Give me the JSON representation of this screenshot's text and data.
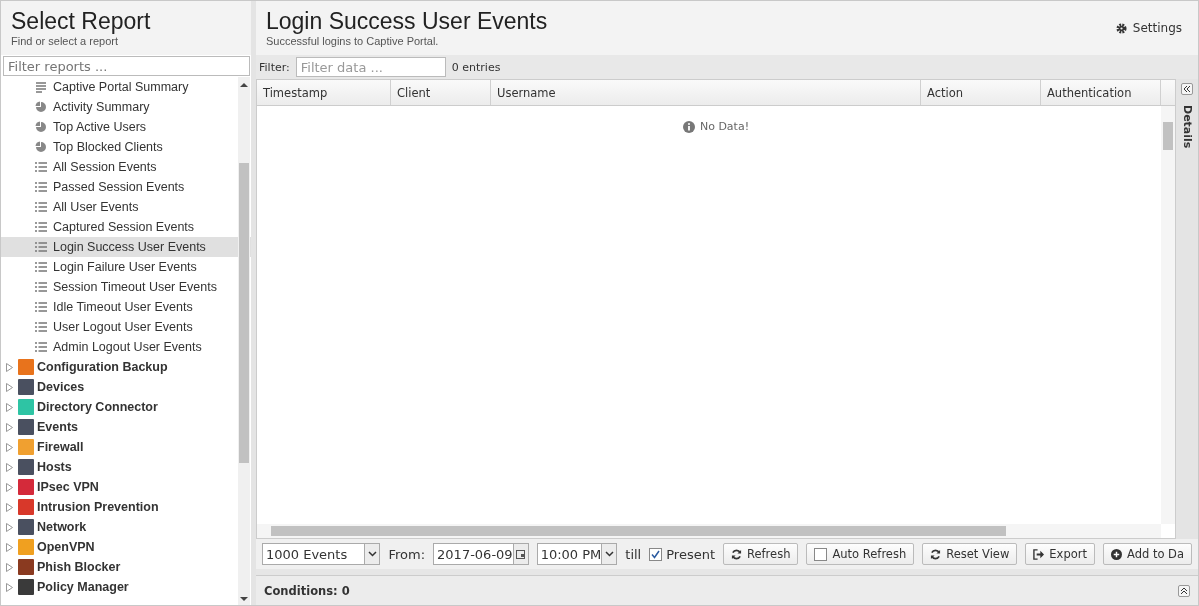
{
  "sidebar": {
    "title": "Select Report",
    "subtitle": "Find or select a report",
    "filter_placeholder": "Filter reports ...",
    "items": [
      {
        "kind": "summary",
        "label": "Captive Portal Summary",
        "selected": false
      },
      {
        "kind": "chart",
        "label": "Activity Summary",
        "selected": false
      },
      {
        "kind": "chart",
        "label": "Top Active Users",
        "selected": false
      },
      {
        "kind": "chart",
        "label": "Top Blocked Clients",
        "selected": false
      },
      {
        "kind": "events",
        "label": "All Session Events",
        "selected": false
      },
      {
        "kind": "events",
        "label": "Passed Session Events",
        "selected": false
      },
      {
        "kind": "events",
        "label": "All User Events",
        "selected": false
      },
      {
        "kind": "events",
        "label": "Captured Session Events",
        "selected": false
      },
      {
        "kind": "events",
        "label": "Login Success User Events",
        "selected": true
      },
      {
        "kind": "events",
        "label": "Login Failure User Events",
        "selected": false
      },
      {
        "kind": "events",
        "label": "Session Timeout User Events",
        "selected": false
      },
      {
        "kind": "events",
        "label": "Idle Timeout User Events",
        "selected": false
      },
      {
        "kind": "events",
        "label": "User Logout User Events",
        "selected": false
      },
      {
        "kind": "events",
        "label": "Admin Logout User Events",
        "selected": false
      },
      {
        "kind": "app",
        "label": "Configuration Backup",
        "expanded": false,
        "color": "#e8731c"
      },
      {
        "kind": "app",
        "label": "Devices",
        "expanded": false,
        "color": "#4a5060"
      },
      {
        "kind": "app",
        "label": "Directory Connector",
        "expanded": false,
        "color": "#2ec4a4"
      },
      {
        "kind": "app",
        "label": "Events",
        "expanded": false,
        "color": "#4a5060"
      },
      {
        "kind": "app",
        "label": "Firewall",
        "expanded": false,
        "color": "#f0a030"
      },
      {
        "kind": "app",
        "label": "Hosts",
        "expanded": false,
        "color": "#4a5060"
      },
      {
        "kind": "app",
        "label": "IPsec VPN",
        "expanded": false,
        "color": "#d42a3a"
      },
      {
        "kind": "app",
        "label": "Intrusion Prevention",
        "expanded": false,
        "color": "#d8382a"
      },
      {
        "kind": "app",
        "label": "Network",
        "expanded": false,
        "color": "#4a5060"
      },
      {
        "kind": "app",
        "label": "OpenVPN",
        "expanded": false,
        "color": "#f0a020"
      },
      {
        "kind": "app",
        "label": "Phish Blocker",
        "expanded": false,
        "color": "#8a3a20"
      },
      {
        "kind": "app",
        "label": "Policy Manager",
        "expanded": false,
        "color": "#3a3a3a"
      }
    ]
  },
  "report": {
    "title": "Login Success User Events",
    "subtitle": "Successful logins to Captive Portal.",
    "settings": "Settings"
  },
  "filter": {
    "label": "Filter:",
    "placeholder": "Filter data ...",
    "count": "0 entries"
  },
  "table": {
    "columns": [
      "Timestamp",
      "Client",
      "Username",
      "Action",
      "Authentication"
    ],
    "empty": "No Data!"
  },
  "details_tab": "Details",
  "toolbar": {
    "limit": "1000 Events",
    "from_label": "From:",
    "date": "2017-06-09",
    "time": "10:00 PM",
    "till_label": "till",
    "present": {
      "label": "Present",
      "checked": true
    },
    "buttons": [
      {
        "kind": "refresh",
        "label": "Refresh"
      },
      {
        "kind": "checkbox",
        "label": "Auto Refresh",
        "checked": false
      },
      {
        "kind": "refresh",
        "label": "Reset View"
      },
      {
        "kind": "export",
        "label": "Export"
      },
      {
        "kind": "add",
        "label": "Add to Da"
      }
    ]
  },
  "conditions": "Conditions: 0"
}
